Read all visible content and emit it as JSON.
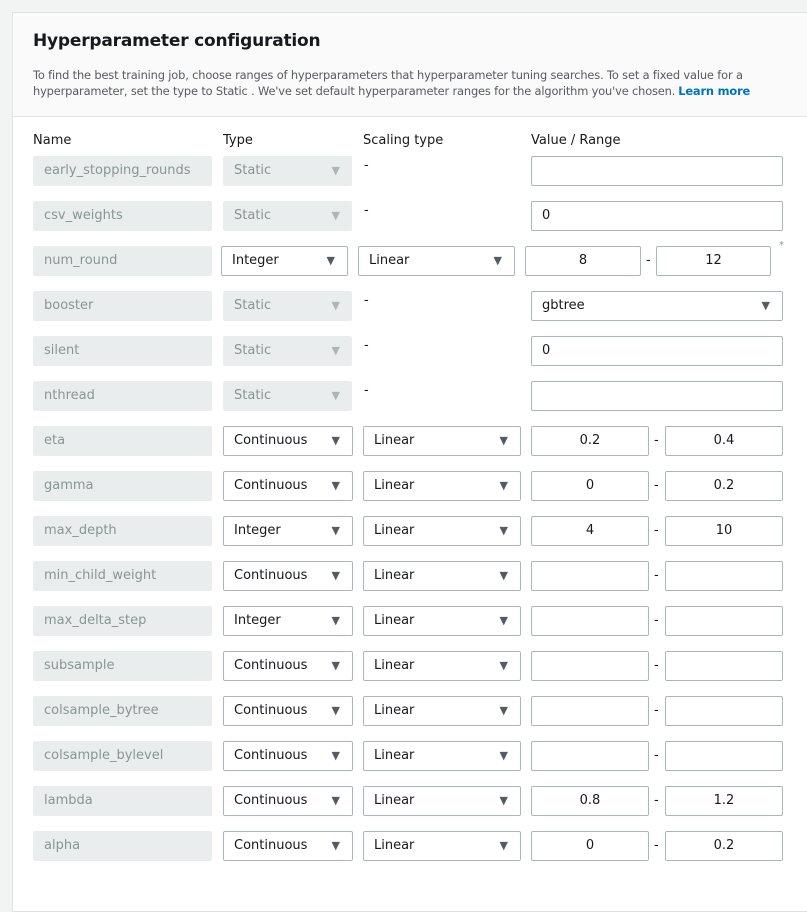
{
  "header": {
    "title": "Hyperparameter configuration",
    "description": "To find the best training job, choose ranges of hyperparameters that hyperparameter tuning searches. To set a fixed value for a hyperparameter, set the type to Static . We've set default hyperparameter ranges for the algorithm you've chosen.",
    "learn_more": "Learn more"
  },
  "columns": {
    "name": "Name",
    "type": "Type",
    "scaling": "Scaling type",
    "value": "Value / Range"
  },
  "icons": {
    "dropdown_arrow": "▼",
    "required_marker": "*"
  },
  "rows": [
    {
      "name": "early_stopping_rounds",
      "type": "Static",
      "scaling": "-",
      "value": ""
    },
    {
      "name": "csv_weights",
      "type": "Static",
      "scaling": "-",
      "value": "0"
    },
    {
      "name": "num_round",
      "type": "Integer",
      "scaling": "Linear",
      "min": "8",
      "max": "12",
      "range_dash": "-",
      "required": "*"
    },
    {
      "name": "booster",
      "type": "Static",
      "scaling": "-",
      "value": "gbtree"
    },
    {
      "name": "silent",
      "type": "Static",
      "scaling": "-",
      "value": "0"
    },
    {
      "name": "nthread",
      "type": "Static",
      "scaling": "-",
      "value": ""
    },
    {
      "name": "eta",
      "type": "Continuous",
      "scaling": "Linear",
      "min": "0.2",
      "max": "0.4",
      "range_dash": "-"
    },
    {
      "name": "gamma",
      "type": "Continuous",
      "scaling": "Linear",
      "min": "0",
      "max": "0.2",
      "range_dash": "-"
    },
    {
      "name": "max_depth",
      "type": "Integer",
      "scaling": "Linear",
      "min": "4",
      "max": "10",
      "range_dash": "-"
    },
    {
      "name": "min_child_weight",
      "type": "Continuous",
      "scaling": "Linear",
      "min": "",
      "max": "",
      "range_dash": "-"
    },
    {
      "name": "max_delta_step",
      "type": "Integer",
      "scaling": "Linear",
      "min": "",
      "max": "",
      "range_dash": "-"
    },
    {
      "name": "subsample",
      "type": "Continuous",
      "scaling": "Linear",
      "min": "",
      "max": "",
      "range_dash": "-"
    },
    {
      "name": "colsample_bytree",
      "type": "Continuous",
      "scaling": "Linear",
      "min": "",
      "max": "",
      "range_dash": "-"
    },
    {
      "name": "colsample_bylevel",
      "type": "Continuous",
      "scaling": "Linear",
      "min": "",
      "max": "",
      "range_dash": "-"
    },
    {
      "name": "lambda",
      "type": "Continuous",
      "scaling": "Linear",
      "min": "0.8",
      "max": "1.2",
      "range_dash": "-"
    },
    {
      "name": "alpha",
      "type": "Continuous",
      "scaling": "Linear",
      "min": "0",
      "max": "0.2",
      "range_dash": "-"
    }
  ]
}
